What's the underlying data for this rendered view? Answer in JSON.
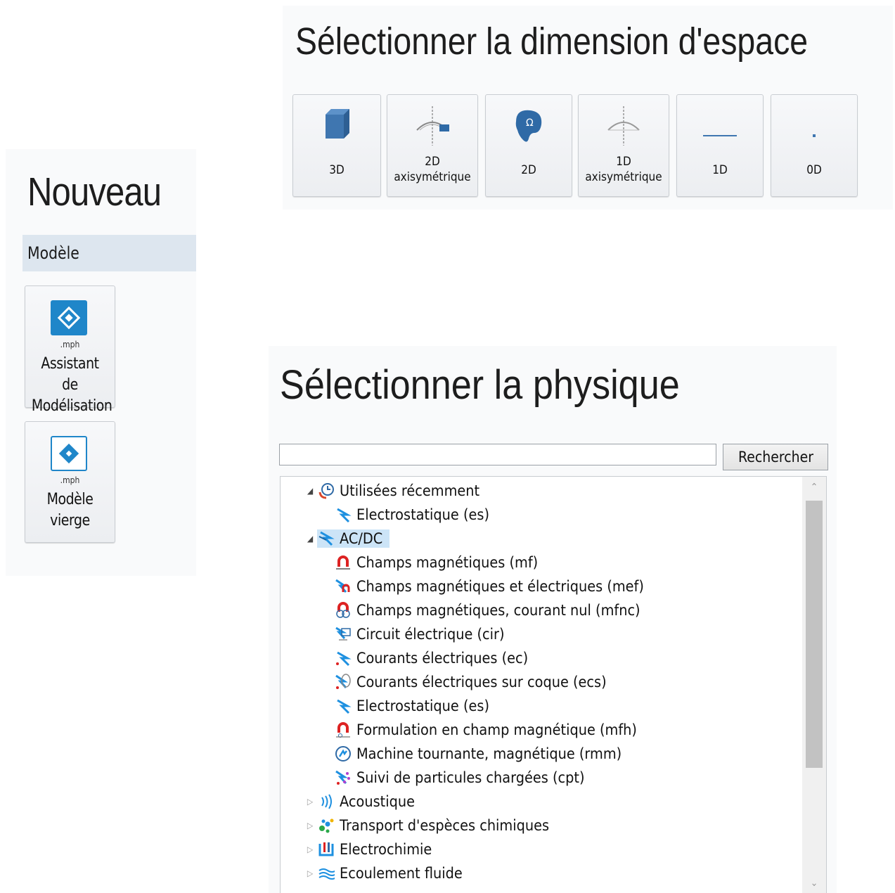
{
  "new_panel": {
    "title": "Nouveau",
    "section": "Modèle",
    "tiles": [
      {
        "ext": ".mph",
        "line1": "Assistant de",
        "line2": "Modélisation",
        "icon": "model-wizard-icon"
      },
      {
        "ext": ".mph",
        "line1": "Modèle",
        "line2": "vierge",
        "icon": "blank-model-icon"
      }
    ]
  },
  "space_panel": {
    "title": "Sélectionner la dimension d'espace",
    "buttons": [
      {
        "line1": "3D",
        "line2": "",
        "icon": "cube-3d-icon"
      },
      {
        "line1": "2D",
        "line2": "axisymétrique",
        "icon": "axisymmetric-2d-icon"
      },
      {
        "line1": "2D",
        "line2": "",
        "icon": "omega-2d-icon"
      },
      {
        "line1": "1D",
        "line2": "axisymétrique",
        "icon": "axisymmetric-1d-icon"
      },
      {
        "line1": "1D",
        "line2": "",
        "icon": "line-1d-icon"
      },
      {
        "line1": "0D",
        "line2": "",
        "icon": "point-0d-icon"
      }
    ]
  },
  "physics_panel": {
    "title": "Sélectionner la physique",
    "search_value": "",
    "search_button": "Rechercher",
    "tree": [
      {
        "label": "Utilisées récemment",
        "level": 0,
        "expanded": true,
        "icon": "recent-clock-icon"
      },
      {
        "label": "Electrostatique (es)",
        "level": 1,
        "icon": "electrostatics-icon"
      },
      {
        "label": "AC/DC",
        "level": 0,
        "expanded": true,
        "selected": true,
        "icon": "acdc-icon"
      },
      {
        "label": "Champs magnétiques (mf)",
        "level": 1,
        "icon": "magnetic-fields-icon"
      },
      {
        "label": "Champs magnétiques et électriques (mef)",
        "level": 1,
        "icon": "magnetic-electric-fields-icon"
      },
      {
        "label": "Champs magnétiques, courant nul (mfnc)",
        "level": 1,
        "icon": "magnetic-no-current-icon"
      },
      {
        "label": "Circuit électrique (cir)",
        "level": 1,
        "icon": "electric-circuit-icon"
      },
      {
        "label": "Courants électriques (ec)",
        "level": 1,
        "icon": "electric-currents-icon"
      },
      {
        "label": "Courants électriques sur coque (ecs)",
        "level": 1,
        "icon": "electric-currents-shell-icon"
      },
      {
        "label": "Electrostatique (es)",
        "level": 1,
        "icon": "electrostatics-icon"
      },
      {
        "label": "Formulation en champ magnétique (mfh)",
        "level": 1,
        "icon": "magnetic-field-formulation-icon"
      },
      {
        "label": "Machine tournante, magnétique (rmm)",
        "level": 1,
        "icon": "rotating-machinery-icon"
      },
      {
        "label": "Suivi de particules chargées (cpt)",
        "level": 1,
        "icon": "charged-particle-tracing-icon"
      },
      {
        "label": "Acoustique",
        "level": 0,
        "expanded": false,
        "icon": "acoustics-icon"
      },
      {
        "label": "Transport d'espèces chimiques",
        "level": 0,
        "expanded": false,
        "icon": "chemical-species-icon"
      },
      {
        "label": "Electrochimie",
        "level": 0,
        "expanded": false,
        "icon": "electrochemistry-icon"
      },
      {
        "label": "Ecoulement fluide",
        "level": 0,
        "expanded": false,
        "icon": "fluid-flow-icon"
      }
    ]
  }
}
